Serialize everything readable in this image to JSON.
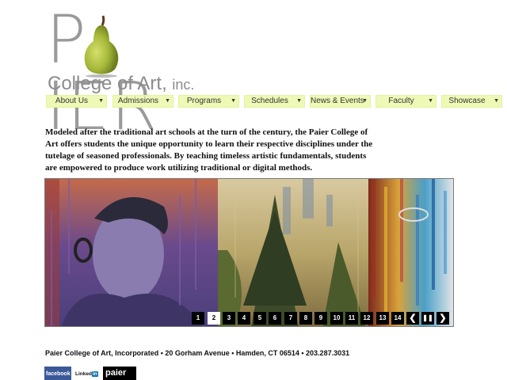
{
  "logo": {
    "left_letter": "P",
    "right_letters": "IER",
    "subtitle": "College of Art,",
    "suffix": "inc."
  },
  "nav": {
    "items": [
      {
        "label": "About Us"
      },
      {
        "label": "Admissions"
      },
      {
        "label": "Programs"
      },
      {
        "label": "Schedules"
      },
      {
        "label": "News & Events"
      },
      {
        "label": "Faculty"
      },
      {
        "label": "Showcase"
      }
    ],
    "caret": "▼",
    "color": "#eef9b6"
  },
  "intro": {
    "text": "Modeled after the traditional art schools at the turn of the century, the Paier College of Art offers students the unique opportunity to learn their respective disciplines under the tutelage of seasoned professionals. By teaching timeless artistic fundamentals, students are empowered to produce work utilizing traditional or digital methods."
  },
  "slideshow": {
    "pages": [
      "1",
      "2",
      "3",
      "4",
      "5",
      "6",
      "7",
      "8",
      "9",
      "10",
      "11",
      "12",
      "13",
      "14"
    ],
    "active_page": "2",
    "prev_icon": "chevron-left-icon",
    "pause_icon": "pause-icon",
    "next_icon": "chevron-right-icon",
    "prev_label": "❮",
    "pause_label": "❚❚",
    "next_label": "❯"
  },
  "footer": {
    "address": "Paier College of Art, Incorporated • 20 Gorham Avenue • Hamden, CT 06514 • 203.287.3031",
    "facebook": "facebook",
    "linkedin_text": "Linked",
    "linkedin_in": "in",
    "paier": "paier"
  }
}
